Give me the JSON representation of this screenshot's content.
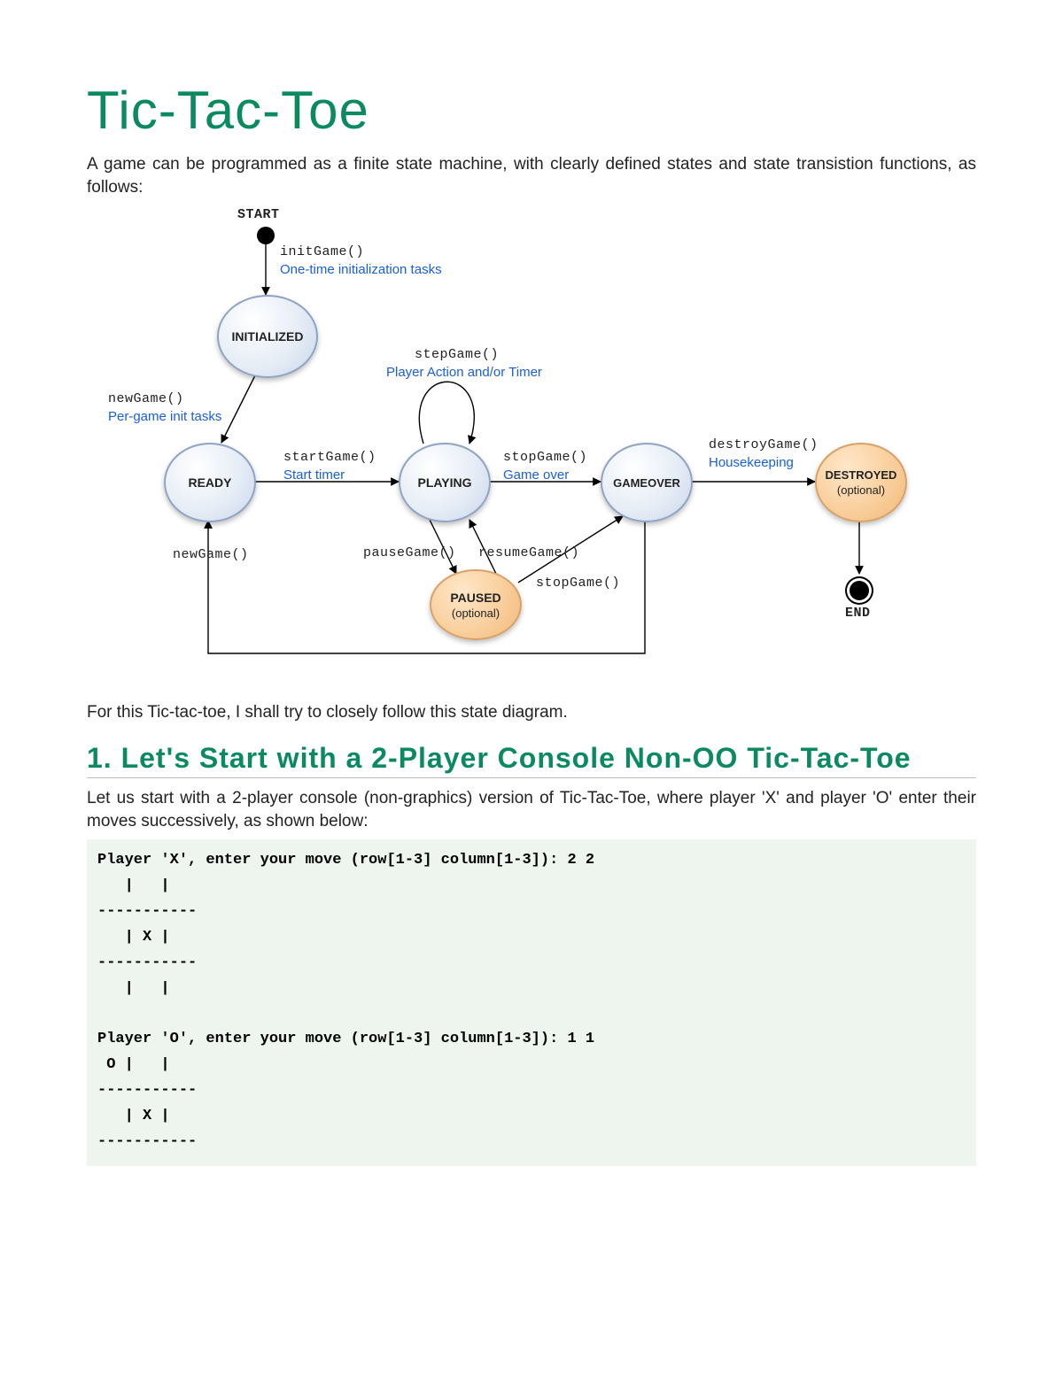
{
  "title": "Tic-Tac-Toe",
  "intro": "A game can be programmed as a finite state machine, with clearly defined states and state transistion functions, as follows:",
  "diagram": {
    "startLabel": "START",
    "endLabel": "END",
    "states": {
      "initialized": "INITIALIZED",
      "ready": "READY",
      "playing": "PLAYING",
      "gameover": "GAMEOVER",
      "paused": "PAUSED",
      "pausedSub": "(optional)",
      "destroyed": "DESTROYED",
      "destroyedSub": "(optional)"
    },
    "trans": {
      "initGame": "initGame()",
      "initGameDesc": "One-time initialization tasks",
      "newGame": "newGame()",
      "newGameDesc": "Per-game init tasks",
      "startGame": "startGame()",
      "startGameDesc": "Start timer",
      "stepGame": "stepGame()",
      "stepGameDesc": "Player Action and/or Timer",
      "stopGame": "stopGame()",
      "stopGameDesc": "Game over",
      "destroyGame": "destroyGame()",
      "destroyGameDesc": "Housekeeping",
      "newGame2": "newGame()",
      "pauseGame": "pauseGame()",
      "resumeGame": "resumeGame()",
      "stopGame2": "stopGame()"
    }
  },
  "followText": "For this Tic-tac-toe, I shall try to closely follow this state diagram.",
  "sectionHeading": "1.  Let's Start with a 2-Player Console Non-OO Tic-Tac-Toe",
  "sectionIntro": "Let us start with a 2-player console (non-graphics) version of Tic-Tac-Toe, where player 'X' and player 'O' enter their moves successively, as shown below:",
  "console": "Player 'X', enter your move (row[1-3] column[1-3]): 2 2\n   |   |\n-----------\n   | X |\n-----------\n   |   |\n\nPlayer 'O', enter your move (row[1-3] column[1-3]): 1 1\n O |   |\n-----------\n   | X |\n-----------"
}
